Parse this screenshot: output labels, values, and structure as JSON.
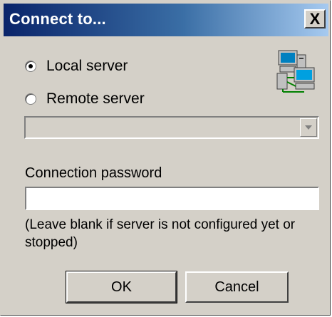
{
  "dialog": {
    "title": "Connect to...",
    "close_label": "X"
  },
  "server_choice": {
    "local_label": "Local server",
    "remote_label": "Remote server",
    "selected": "local",
    "remote_server_value": ""
  },
  "password": {
    "label": "Connection password",
    "value": "",
    "hint": "(Leave blank if server is not configured yet or stopped)"
  },
  "buttons": {
    "ok_label": "OK",
    "cancel_label": "Cancel"
  },
  "icons": {
    "server": "network-computers-icon",
    "combo_arrow": "chevron-down-icon"
  },
  "colors": {
    "title_gradient_start": "#0a246a",
    "title_gradient_end": "#a6caf0",
    "dialog_face": "#d4d0c8"
  }
}
